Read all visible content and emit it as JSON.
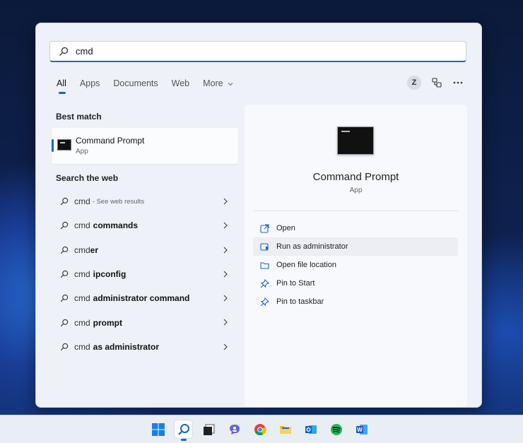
{
  "search": {
    "query": "cmd",
    "placeholder": ""
  },
  "tabs": [
    {
      "label": "All",
      "active": true
    },
    {
      "label": "Apps",
      "active": false
    },
    {
      "label": "Documents",
      "active": false
    },
    {
      "label": "Web",
      "active": false
    },
    {
      "label": "More",
      "active": false
    }
  ],
  "account": {
    "initial": "Z"
  },
  "best_match": {
    "heading": "Best match",
    "title": "Command Prompt",
    "subtitle": "App"
  },
  "web": {
    "heading": "Search the web",
    "items": [
      {
        "query": "cmd",
        "bold": "",
        "hint": "- See web results"
      },
      {
        "query": "cmd",
        "bold": "commands",
        "hint": ""
      },
      {
        "query": "cmd",
        "bold": "er",
        "hint": ""
      },
      {
        "query": "cmd",
        "bold": "ipconfig",
        "hint": ""
      },
      {
        "query": "cmd",
        "bold": "administrator command",
        "hint": ""
      },
      {
        "query": "cmd",
        "bold": "prompt",
        "hint": ""
      },
      {
        "query": "cmd",
        "bold": "as administrator",
        "hint": ""
      }
    ]
  },
  "preview": {
    "title": "Command Prompt",
    "subtitle": "App",
    "actions": [
      {
        "label": "Open",
        "icon": "open-icon"
      },
      {
        "label": "Run as administrator",
        "icon": "shield-admin-icon"
      },
      {
        "label": "Open file location",
        "icon": "folder-icon"
      },
      {
        "label": "Pin to Start",
        "icon": "pin-icon"
      },
      {
        "label": "Pin to taskbar",
        "icon": "pin-icon"
      }
    ]
  },
  "taskbar": {
    "apps": [
      "windows-start-icon",
      "search-icon",
      "task-view-icon",
      "chat-icon",
      "chrome-icon",
      "file-explorer-icon",
      "outlook-icon",
      "spotify-icon",
      "word-icon"
    ]
  },
  "colors": {
    "accent": "#1a66c8"
  }
}
